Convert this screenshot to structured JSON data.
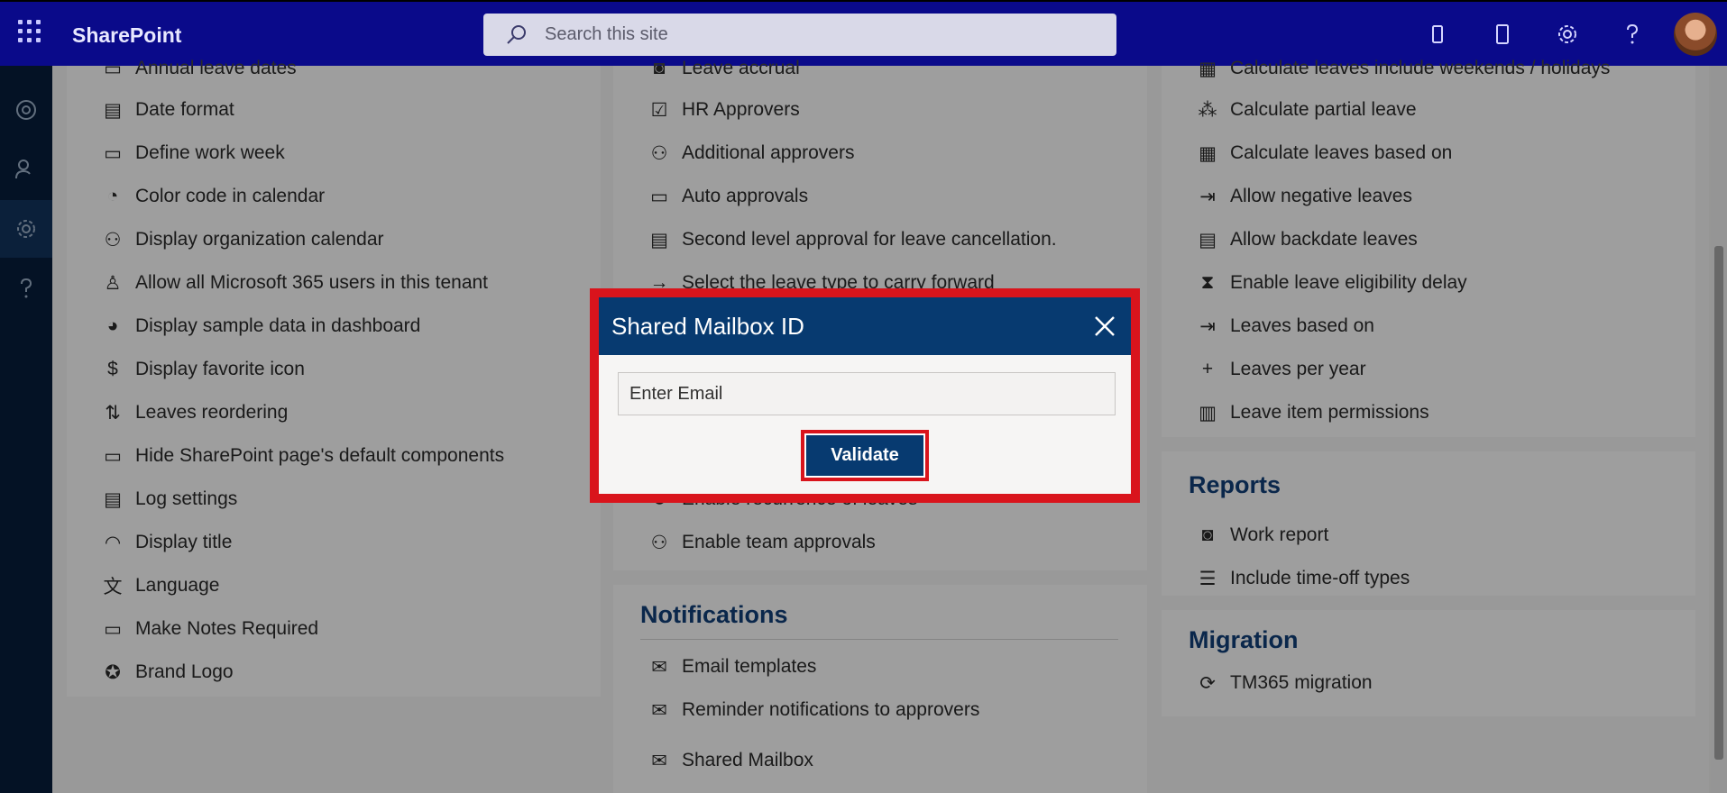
{
  "app": {
    "brand": "SharePoint",
    "search_placeholder": "Search this site"
  },
  "topbar_icons": [
    "waffle-icon",
    "phone-icon",
    "tablet-icon",
    "settings-icon",
    "help-icon",
    "avatar"
  ],
  "rail_icons": [
    "activity-icon",
    "people-icon",
    "settings-icon",
    "help-icon"
  ],
  "column1": {
    "items": [
      "Annual leave dates",
      "Date format",
      "Define work week",
      "Color code in calendar",
      "Display organization calendar",
      "Allow all Microsoft 365 users in this tenant",
      "Display sample data in dashboard",
      "Display favorite icon",
      "Leaves reordering",
      "Hide SharePoint page's default components",
      "Log settings",
      "Display title",
      "Language",
      "Make Notes Required",
      "Brand Logo"
    ]
  },
  "column2": {
    "items_top": [
      "Leave accrual",
      "HR Approvers",
      "Additional approvers",
      "Auto approvals",
      "Second level approval for leave cancellation.",
      "Select the leave type to carry forward"
    ],
    "items_bottom": [
      "Enable recurrence of leaves",
      "Enable team approvals"
    ],
    "notifications": {
      "title": "Notifications",
      "items": [
        "Email templates",
        "Reminder notifications to approvers",
        "Shared Mailbox"
      ]
    }
  },
  "column3": {
    "items": [
      "Calculate leaves include weekends / holidays",
      "Calculate partial leave",
      "Calculate leaves based on",
      "Allow negative leaves",
      "Allow backdate leaves",
      "Enable leave eligibility delay",
      "Leaves based on",
      "Leaves per year",
      "Leave item permissions"
    ],
    "reports": {
      "title": "Reports",
      "items": [
        "Work report",
        "Include time-off types"
      ]
    },
    "migration": {
      "title": "Migration",
      "items": [
        "TM365 migration"
      ]
    }
  },
  "dialog": {
    "title": "Shared Mailbox ID",
    "input_placeholder": "Enter Email",
    "input_value": "",
    "validate_label": "Validate"
  },
  "colors": {
    "topbar": "#0a0a8a",
    "rail": "#071d3c",
    "dialog_header": "#073a70",
    "highlight": "#d9141c"
  }
}
